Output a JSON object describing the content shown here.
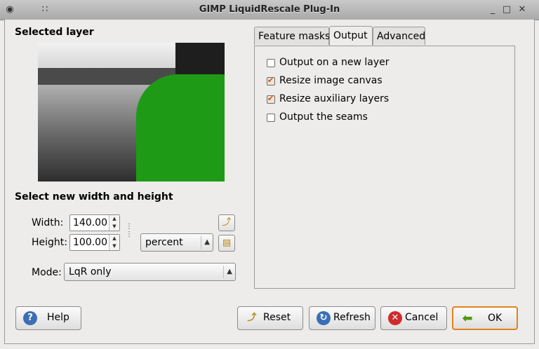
{
  "window": {
    "title": "GIMP LiquidRescale Plug-In"
  },
  "left": {
    "selected_layer_heading": "Selected layer",
    "size_heading": "Select new width and height",
    "width_label": "Width:",
    "width_value": "140.00",
    "height_label": "Height:",
    "height_value": "100.00",
    "units_value": "percent",
    "mode_label": "Mode:",
    "mode_value": "LqR only"
  },
  "tabs": [
    {
      "label": "Feature masks",
      "active": false
    },
    {
      "label": "Output",
      "active": true
    },
    {
      "label": "Advanced",
      "active": false
    }
  ],
  "output_options": [
    {
      "label": "Output on a new layer",
      "checked": false
    },
    {
      "label": "Resize image canvas",
      "checked": true
    },
    {
      "label": "Resize auxiliary layers",
      "checked": true
    },
    {
      "label": "Output the seams",
      "checked": false
    }
  ],
  "buttons": {
    "help": "Help",
    "reset": "Reset",
    "refresh": "Refresh",
    "cancel": "Cancel",
    "ok": "OK"
  },
  "colors": {
    "ok_border": "#e0821c",
    "mask_green": "#1f9a16",
    "check_mark": "#c4561a"
  }
}
